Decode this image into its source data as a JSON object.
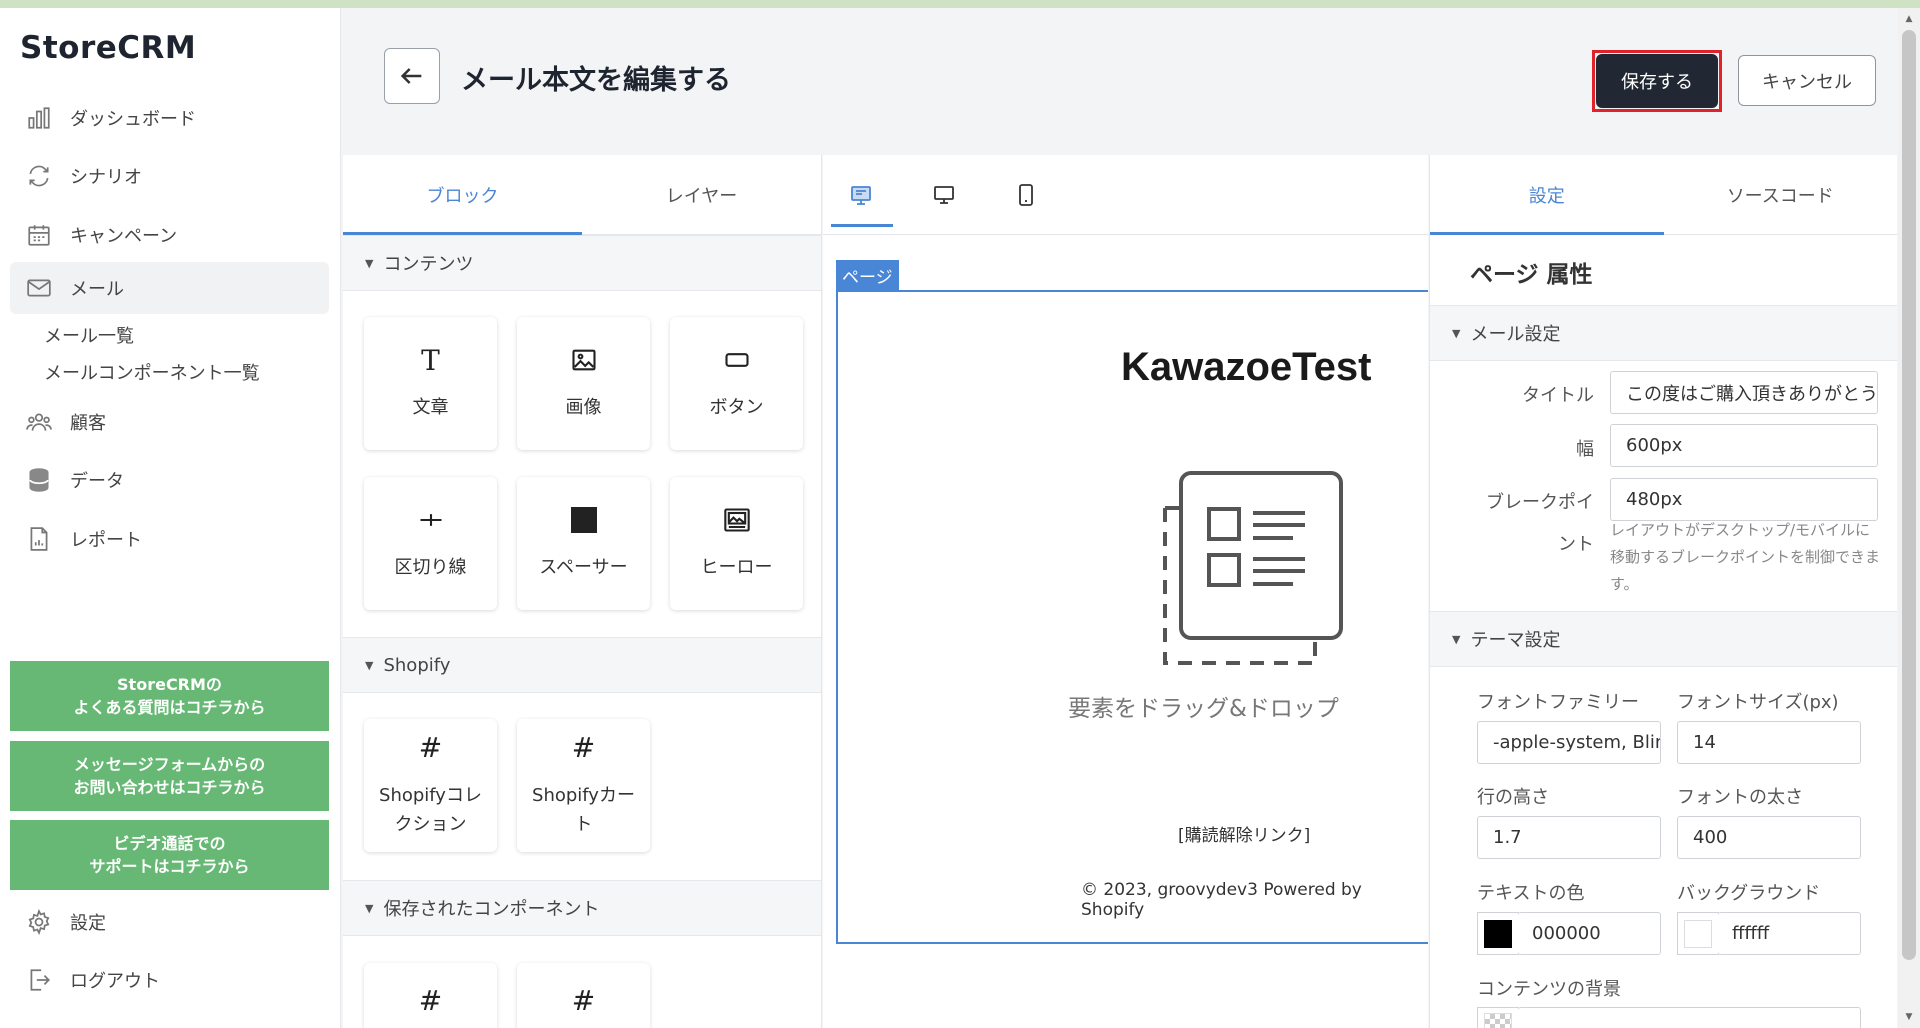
{
  "app": {
    "brand": "StoreCRM"
  },
  "sidebar": {
    "items": [
      {
        "label": "ダッシュボード",
        "icon": "bar-chart-icon"
      },
      {
        "label": "シナリオ",
        "icon": "refresh-icon"
      },
      {
        "label": "キャンペーン",
        "icon": "calendar-icon"
      },
      {
        "label": "メール",
        "icon": "mail-icon"
      },
      {
        "label": "顧客",
        "icon": "users-icon"
      },
      {
        "label": "データ",
        "icon": "database-icon"
      },
      {
        "label": "レポート",
        "icon": "report-icon"
      }
    ],
    "mail_sub": [
      "メール一覧",
      "メールコンポーネント一覧"
    ],
    "help_buttons": [
      "StoreCRMの\nよくある質問はコチラから",
      "メッセージフォームからの\nお問い合わせはコチラから",
      "ビデオ通話での\nサポートはコチラから"
    ],
    "bottom": [
      {
        "label": "設定",
        "icon": "gear-icon"
      },
      {
        "label": "ログアウト",
        "icon": "logout-icon"
      }
    ]
  },
  "header": {
    "title": "メール本文を編集する",
    "save_label": "保存する",
    "cancel_label": "キャンセル"
  },
  "blocks_panel": {
    "tabs": [
      "ブロック",
      "レイヤー"
    ],
    "sections": [
      "コンテンツ",
      "Shopify",
      "保存されたコンポーネント"
    ],
    "content_blocks": [
      "文章",
      "画像",
      "ボタン",
      "区切り線",
      "スペーサー",
      "ヒーロー"
    ],
    "shopify_blocks": [
      "Shopifyコレクション",
      "Shopifyカート"
    ]
  },
  "canvas": {
    "page_tag": "ページ",
    "email_title": "KawazoeTest",
    "dnd_text": "要素をドラッグ&ドロップ",
    "unsubscribe": "[購読解除リンク]",
    "copyright": "© 2023, groovydev3 Powered by Shopify"
  },
  "settings": {
    "tabs": [
      "設定",
      "ソースコード"
    ],
    "title": "ページ 属性",
    "mail_section": "メール設定",
    "title_label": "タイトル",
    "title_value": "この度はご購入頂きありがとうございます",
    "width_label": "幅",
    "width_value": "600px",
    "breakpoint_label_1": "ブレークポイ",
    "breakpoint_label_2": "ント",
    "breakpoint_value": "480px",
    "breakpoint_hint": "レイアウトがデスクトップ/モバイルに移動するブレークポイントを制御できます。",
    "theme_section": "テーマ設定",
    "font_family_label": "フォントファミリー",
    "font_family_value": "-apple-system, BlinkMacSystemFont",
    "font_size_label": "フォントサイズ(px)",
    "font_size_value": "14",
    "line_height_label": "行の高さ",
    "line_height_value": "1.7",
    "font_weight_label": "フォントの太さ",
    "font_weight_value": "400",
    "text_color_label": "テキストの色",
    "text_color_value": "000000",
    "background_label": "バックグラウンド",
    "background_value": "ffffff",
    "content_bg_label": "コンテンツの背景"
  },
  "colors": {
    "accent": "#4a86d6",
    "help_green": "#66b874",
    "save_dark": "#222833",
    "highlight_red": "#e0232a"
  }
}
